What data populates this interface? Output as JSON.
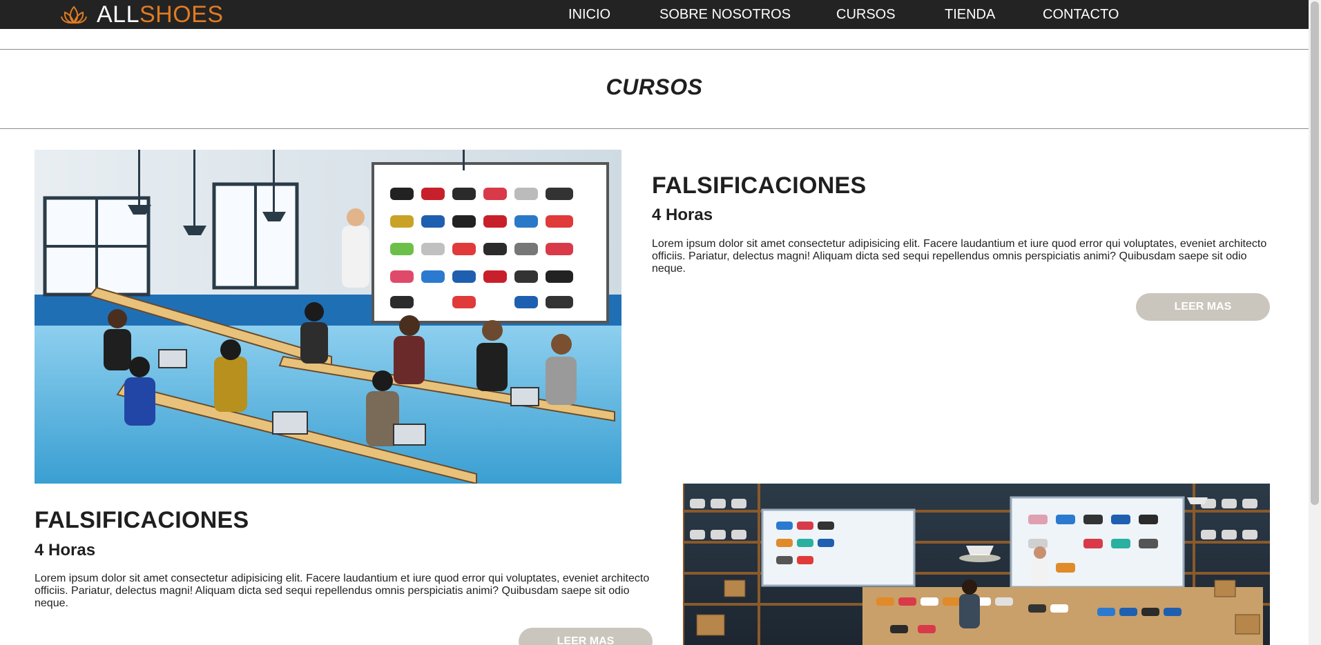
{
  "brand": {
    "part1": "ALL",
    "part2": "SHOES",
    "icon": "lotus-icon",
    "accent_color": "#e07b22"
  },
  "nav": {
    "items": [
      {
        "label": "INICIO"
      },
      {
        "label": "SOBRE NOSOTROS"
      },
      {
        "label": "CURSOS"
      },
      {
        "label": "TIENDA"
      },
      {
        "label": "CONTACTO"
      }
    ]
  },
  "page": {
    "title": "CURSOS"
  },
  "courses": [
    {
      "title": "FALSIFICACIONES",
      "hours": "4 Horas",
      "description": "Lorem ipsum dolor sit amet consectetur adipisicing elit. Facere laudantium et iure quod error qui voluptates, eveniet architecto officiis. Pariatur, delectus magni! Aliquam dicta sed sequi repellendus omnis perspiciatis animi? Quibusdam saepe sit odio neque.",
      "button": "LEER MAS",
      "image": "classroom-sneaker-workshop-illustration"
    },
    {
      "title": "FALSIFICACIONES",
      "hours": "4 Horas",
      "description": "Lorem ipsum dolor sit amet consectetur adipisicing elit. Facere laudantium et iure quod error qui voluptates, eveniet architecto officiis. Pariatur, delectus magni! Aliquam dicta sed sequi repellendus omnis perspiciatis animi? Quibusdam saepe sit odio neque.",
      "button": "LEER MAS",
      "image": "sneaker-warehouse-inspection-illustration"
    }
  ],
  "colors": {
    "navbar_bg": "#232323",
    "button_bg": "#cbc6bd"
  }
}
